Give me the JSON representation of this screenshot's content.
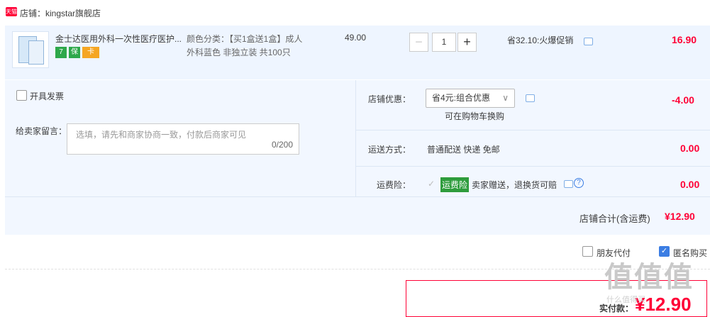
{
  "shop": {
    "logo_text": "天猫",
    "name": "店铺：kingstar旗舰店"
  },
  "item": {
    "title": "金士达医用外科一次性医疗医护...",
    "sku_line1": "颜色分类：【买1盒送1盒】成人",
    "sku_line2": "外科蓝色 非独立装 共100只",
    "price": "49.00",
    "qty_minus": "−",
    "qty": "1",
    "qty_plus": "+",
    "promo": "省32.10:火爆促销",
    "subtotal": "16.90",
    "badges": [
      "7",
      "保",
      "卡"
    ]
  },
  "options": {
    "invoice_label": "开具发票",
    "memo_label": "给卖家留言：",
    "memo_placeholder": "选填，请先和商家协商一致，付款后商家可见",
    "memo_count": "0/200",
    "discount_label": "店铺优惠：",
    "discount_select": "省4元:组合优惠",
    "discount_note": "可在购物车换购",
    "discount_amount": "-4.00",
    "shipping_label": "运送方式：",
    "shipping_value": "普通配送 快递 免邮",
    "shipping_amount": "0.00",
    "insurance_label": "运费险：",
    "insurance_badge": "运费险",
    "insurance_text": "卖家赠送，退换货可赔",
    "insurance_amount": "0.00",
    "total_label": "店铺合计(含运费)",
    "total_amount": "¥12.90"
  },
  "footer": {
    "friend_pay": "朋友代付",
    "anon_buy": "匿名购买",
    "anon_checked": true,
    "pay_label": "实付款：",
    "pay_amount": "¥12.90"
  },
  "watermark": {
    "text": "值值值",
    "sub": "什么值得买"
  },
  "colors": {
    "accent": "#ff0036",
    "panel": "#eef5ff",
    "check": "#3b7de3",
    "badge_green": "#2e9c3c"
  }
}
